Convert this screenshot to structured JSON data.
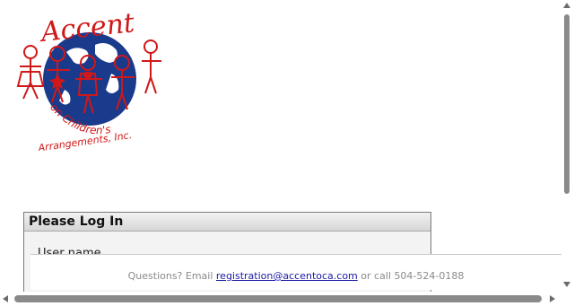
{
  "logo": {
    "line1": "Accent",
    "line2": "on Children's",
    "line3": "Arrangements, Inc."
  },
  "login": {
    "title": "Please Log In",
    "username_label": "User name"
  },
  "footer": {
    "prefix": "Questions? Email ",
    "email": "registration@accentoca.com",
    "middle": " or call ",
    "phone": "504-524-0188"
  },
  "colors": {
    "logo_red": "#d01818",
    "globe_blue": "#1a3a8c",
    "link": "#1a1aa6"
  }
}
